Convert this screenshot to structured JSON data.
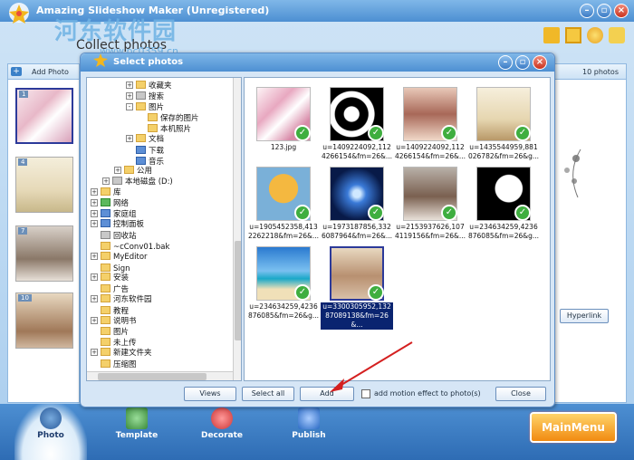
{
  "app": {
    "title": "Amazing Slideshow Maker (Unregistered)",
    "heading": "Collect photos",
    "watermark": "河东软件园",
    "watermark_url": "www.pc0359.cn"
  },
  "left_panel": {
    "add_photo_label": "Add Photo",
    "slots": [
      {
        "num": "1",
        "selected": true
      },
      {
        "num": "4",
        "selected": false
      },
      {
        "num": "7",
        "selected": false
      },
      {
        "num": "10",
        "selected": false
      }
    ]
  },
  "right_panel": {
    "photo_count": "10 photos",
    "hyperlink_label": "Hyperlink"
  },
  "bottom_tabs": [
    {
      "label": "Photo",
      "active": true
    },
    {
      "label": "Template",
      "active": false
    },
    {
      "label": "Decorate",
      "active": false
    },
    {
      "label": "Publish",
      "active": false
    }
  ],
  "main_menu_label": "MainMenu",
  "dialog": {
    "title": "Select photos",
    "tree": [
      {
        "label": "收藏夹",
        "level": 3,
        "exp": "+",
        "icon": "star"
      },
      {
        "label": "搜索",
        "level": 3,
        "exp": "+",
        "icon": "search"
      },
      {
        "label": "图片",
        "level": 3,
        "exp": "-",
        "icon": "folder"
      },
      {
        "label": "保存的图片",
        "level": 4,
        "exp": "",
        "icon": "folder"
      },
      {
        "label": "本机照片",
        "level": 4,
        "exp": "",
        "icon": "folder"
      },
      {
        "label": "文档",
        "level": 3,
        "exp": "+",
        "icon": "folder"
      },
      {
        "label": "下载",
        "level": 3,
        "exp": "",
        "icon": "download"
      },
      {
        "label": "音乐",
        "level": 3,
        "exp": "",
        "icon": "music"
      },
      {
        "label": "公用",
        "level": 2,
        "exp": "+",
        "icon": "folder"
      },
      {
        "label": "本地磁盘 (D:)",
        "level": 1,
        "exp": "+",
        "icon": "drive"
      },
      {
        "label": "库",
        "level": 0,
        "exp": "+",
        "icon": "folder"
      },
      {
        "label": "网络",
        "level": 0,
        "exp": "+",
        "icon": "network"
      },
      {
        "label": "家庭组",
        "level": 0,
        "exp": "+",
        "icon": "homegroup"
      },
      {
        "label": "控制面板",
        "level": 0,
        "exp": "+",
        "icon": "control"
      },
      {
        "label": "回收站",
        "level": 0,
        "exp": "",
        "icon": "recycle"
      },
      {
        "label": "~cConv01.bak",
        "level": 0,
        "exp": "",
        "icon": "folder"
      },
      {
        "label": "MyEditor",
        "level": 0,
        "exp": "+",
        "icon": "folder"
      },
      {
        "label": "Sign",
        "level": 0,
        "exp": "",
        "icon": "folder"
      },
      {
        "label": "安装",
        "level": 0,
        "exp": "+",
        "icon": "folder"
      },
      {
        "label": "广告",
        "level": 0,
        "exp": "",
        "icon": "folder"
      },
      {
        "label": "河东软件园",
        "level": 0,
        "exp": "+",
        "icon": "folder"
      },
      {
        "label": "教程",
        "level": 0,
        "exp": "",
        "icon": "folder"
      },
      {
        "label": "说明书",
        "level": 0,
        "exp": "+",
        "icon": "folder"
      },
      {
        "label": "图片",
        "level": 0,
        "exp": "",
        "icon": "folder"
      },
      {
        "label": "未上传",
        "level": 0,
        "exp": "",
        "icon": "folder"
      },
      {
        "label": "新建文件夹",
        "level": 0,
        "exp": "+",
        "icon": "folder"
      },
      {
        "label": "压缩图",
        "level": 0,
        "exp": "",
        "icon": "folder"
      }
    ],
    "photos": [
      {
        "caption": "123.jpg",
        "checked": true,
        "selected": false,
        "art": "floral"
      },
      {
        "caption": "u=1409224092,1124266154&fm=26&...",
        "checked": true,
        "selected": false,
        "art": "bw"
      },
      {
        "caption": "u=1409224092,1124266154&fm=26&...",
        "checked": true,
        "selected": false,
        "art": "portrait"
      },
      {
        "caption": "u=1435544959,881026782&fm=26&g...",
        "checked": true,
        "selected": false,
        "art": "ink"
      },
      {
        "caption": "u=1905452358,4132262218&fm=26&...",
        "checked": true,
        "selected": false,
        "art": "tree"
      },
      {
        "caption": "u=1973187856,3326087964&fm=26&...",
        "checked": true,
        "selected": false,
        "art": "tech"
      },
      {
        "caption": "u=2153937626,1074119156&fm=26&...",
        "checked": true,
        "selected": false,
        "art": "dogs"
      },
      {
        "caption": "u=234634259,4236876085&fm=26&g...",
        "checked": true,
        "selected": false,
        "art": "bwmap"
      },
      {
        "caption": "u=234634259,4236876085&fm=26&g...",
        "checked": true,
        "selected": false,
        "art": "beach"
      },
      {
        "caption": "u=3300305952,13287089138&fm=26&...",
        "checked": true,
        "selected": true,
        "art": "horse"
      }
    ],
    "buttons": {
      "views": "Views",
      "select_all": "Select all",
      "add": "Add",
      "motion_label": "add motion effect to photo(s)",
      "close": "Close"
    }
  }
}
